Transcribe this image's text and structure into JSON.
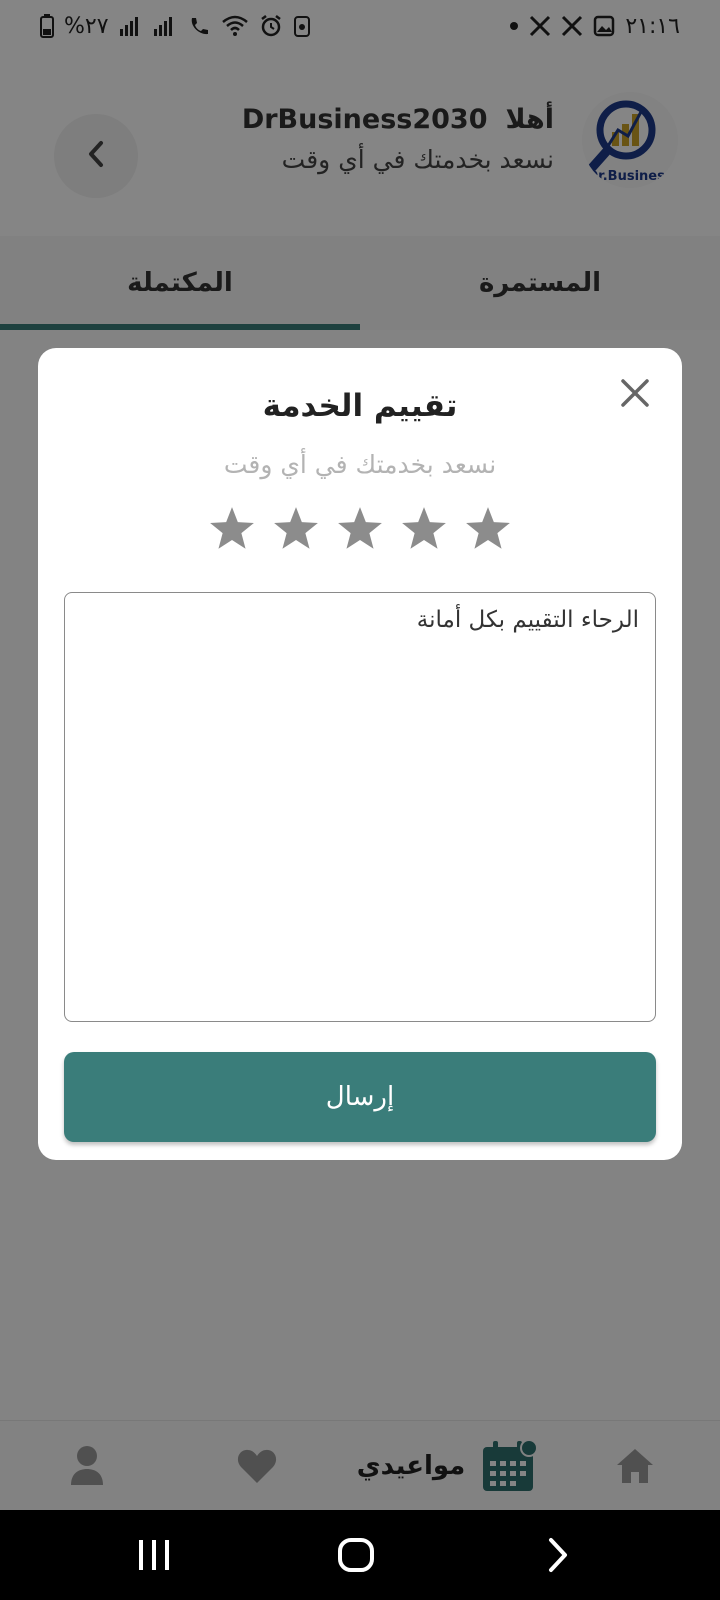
{
  "status_bar": {
    "time": "٢١:١٦",
    "battery": "%٢٧"
  },
  "header": {
    "greeting_word": "أهلا",
    "username": "DrBusiness2030",
    "subtitle": "نسعد بخدمتك في أي وقت",
    "logo_text": "Dr.Business"
  },
  "tabs": [
    {
      "label": "المستمرة",
      "active": false
    },
    {
      "label": "المكتملة",
      "active": true
    }
  ],
  "dialog": {
    "title": "تقييم الخدمة",
    "subtitle": "نسعد بخدمتك في أي وقت",
    "rating": {
      "value": 0,
      "max": 5,
      "star_color": "#8c8c8c"
    },
    "comment_placeholder": "الرحاء التقييم بكل أمانة",
    "submit_label": "إرسال"
  },
  "bottom_nav": {
    "active_label": "مواعيدي",
    "items": [
      "home-icon",
      "calendar-icon",
      "heart-icon",
      "person-icon"
    ]
  },
  "colors": {
    "accent": "#3a7d7a",
    "overlay": "rgba(0,0,0,0.48)"
  }
}
